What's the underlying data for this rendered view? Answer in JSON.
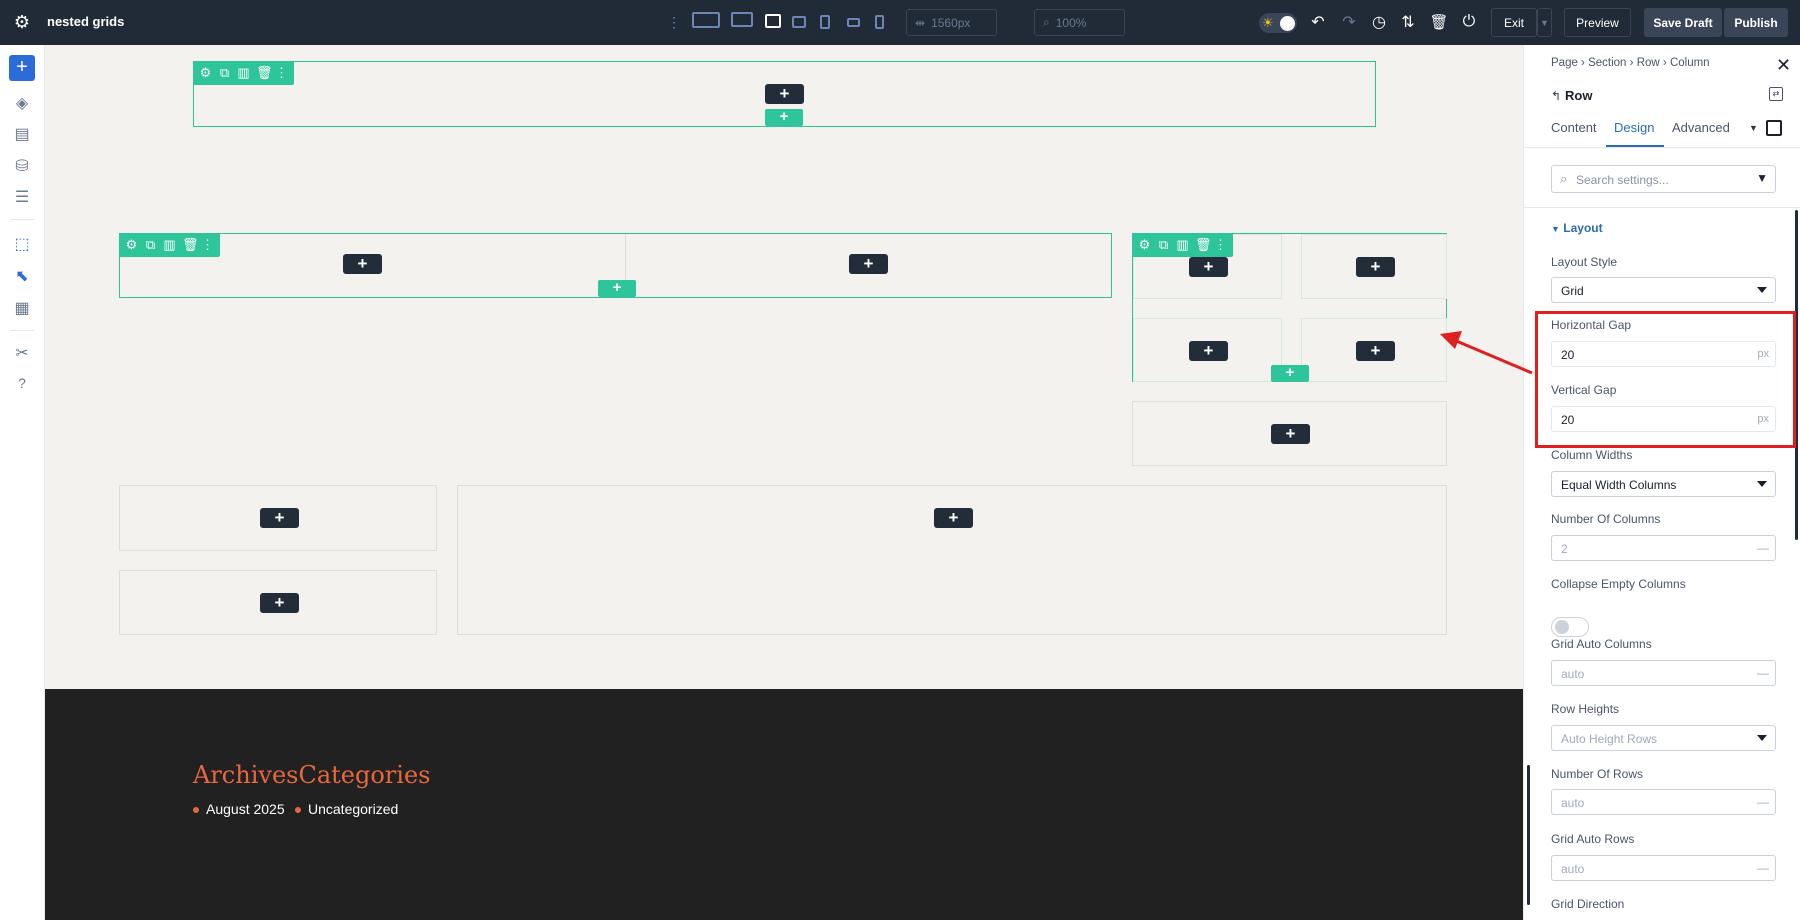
{
  "topbar": {
    "page_title": "nested grids",
    "width_value": "1560px",
    "zoom_value": "100%",
    "exit_label": "Exit",
    "preview_label": "Preview",
    "save_draft_label": "Save Draft",
    "publish_label": "Publish"
  },
  "footer": {
    "heading": "ArchivesCategories",
    "items": [
      "August 2025",
      "Uncategorized"
    ]
  },
  "panel": {
    "breadcrumb": [
      "Page",
      "Section",
      "Row",
      "Column"
    ],
    "title": "Row",
    "tabs": [
      "Content",
      "Design",
      "Advanced"
    ],
    "active_tab": "Design",
    "search_placeholder": "Search settings...",
    "section": "Layout",
    "fields": {
      "layout_style": {
        "label": "Layout Style",
        "value": "Grid"
      },
      "horizontal_gap": {
        "label": "Horizontal Gap",
        "value": "20",
        "unit": "px"
      },
      "vertical_gap": {
        "label": "Vertical Gap",
        "value": "20",
        "unit": "px"
      },
      "column_widths": {
        "label": "Column Widths",
        "value": "Equal Width Columns"
      },
      "number_of_columns": {
        "label": "Number Of Columns",
        "value": "2"
      },
      "collapse_empty_columns": {
        "label": "Collapse Empty Columns",
        "value": false
      },
      "grid_auto_columns": {
        "label": "Grid Auto Columns",
        "value": "auto"
      },
      "row_heights": {
        "label": "Row Heights",
        "value": "Auto Height Rows"
      },
      "number_of_rows": {
        "label": "Number Of Rows",
        "value": "auto"
      },
      "grid_auto_rows": {
        "label": "Grid Auto Rows",
        "value": "auto"
      },
      "grid_direction": {
        "label": "Grid Direction"
      }
    }
  },
  "colors": {
    "accent_green": "#2fc59a",
    "dark": "#212a37",
    "highlight": "#e02020",
    "footer_accent": "#e8683e"
  }
}
